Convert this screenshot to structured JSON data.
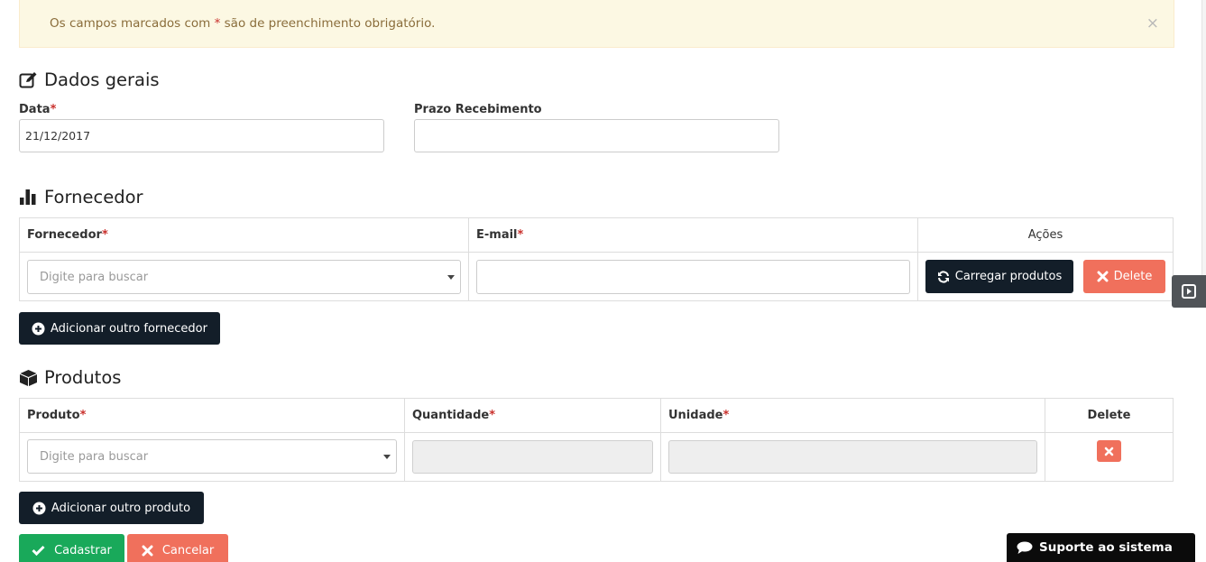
{
  "alert": {
    "text_before": "Os campos marcados com ",
    "asterisk": "*",
    "text_after": " são de preenchimento obrigatório.",
    "close_symbol": "×"
  },
  "general": {
    "title": "Dados gerais",
    "icon": "edit-icon",
    "date_label": "Data",
    "date_value": "21/12/2017",
    "deadline_label": "Prazo Recebimento",
    "deadline_value": ""
  },
  "supplier": {
    "title": "Fornecedor",
    "icon": "bar-chart-icon",
    "headers": {
      "supplier": "Fornecedor",
      "email": "E-mail",
      "actions": "Ações"
    },
    "supplier_placeholder": "Digite para buscar",
    "email_value": "",
    "load_button": "Carregar produtos",
    "delete_button": "Delete",
    "add_button": "Adicionar outro fornecedor"
  },
  "products": {
    "title": "Produtos",
    "icon": "cube-icon",
    "headers": {
      "product": "Produto",
      "quantity": "Quantidade",
      "unit": "Unidade",
      "delete": "Delete"
    },
    "product_placeholder": "Digite para buscar",
    "add_button": "Adicionar outro produto"
  },
  "footer": {
    "submit_button": "Cadastrar",
    "cancel_button": "Cancelar"
  },
  "support": {
    "label": "Suporte ao sistema",
    "icon": "chat-icon"
  },
  "required_mark": "*",
  "colors": {
    "dark_button": "#131e29",
    "red_button": "#f0705c",
    "green_button": "#19a95a",
    "alert_bg": "#fcf8e3",
    "alert_text": "#8a6d3b"
  }
}
